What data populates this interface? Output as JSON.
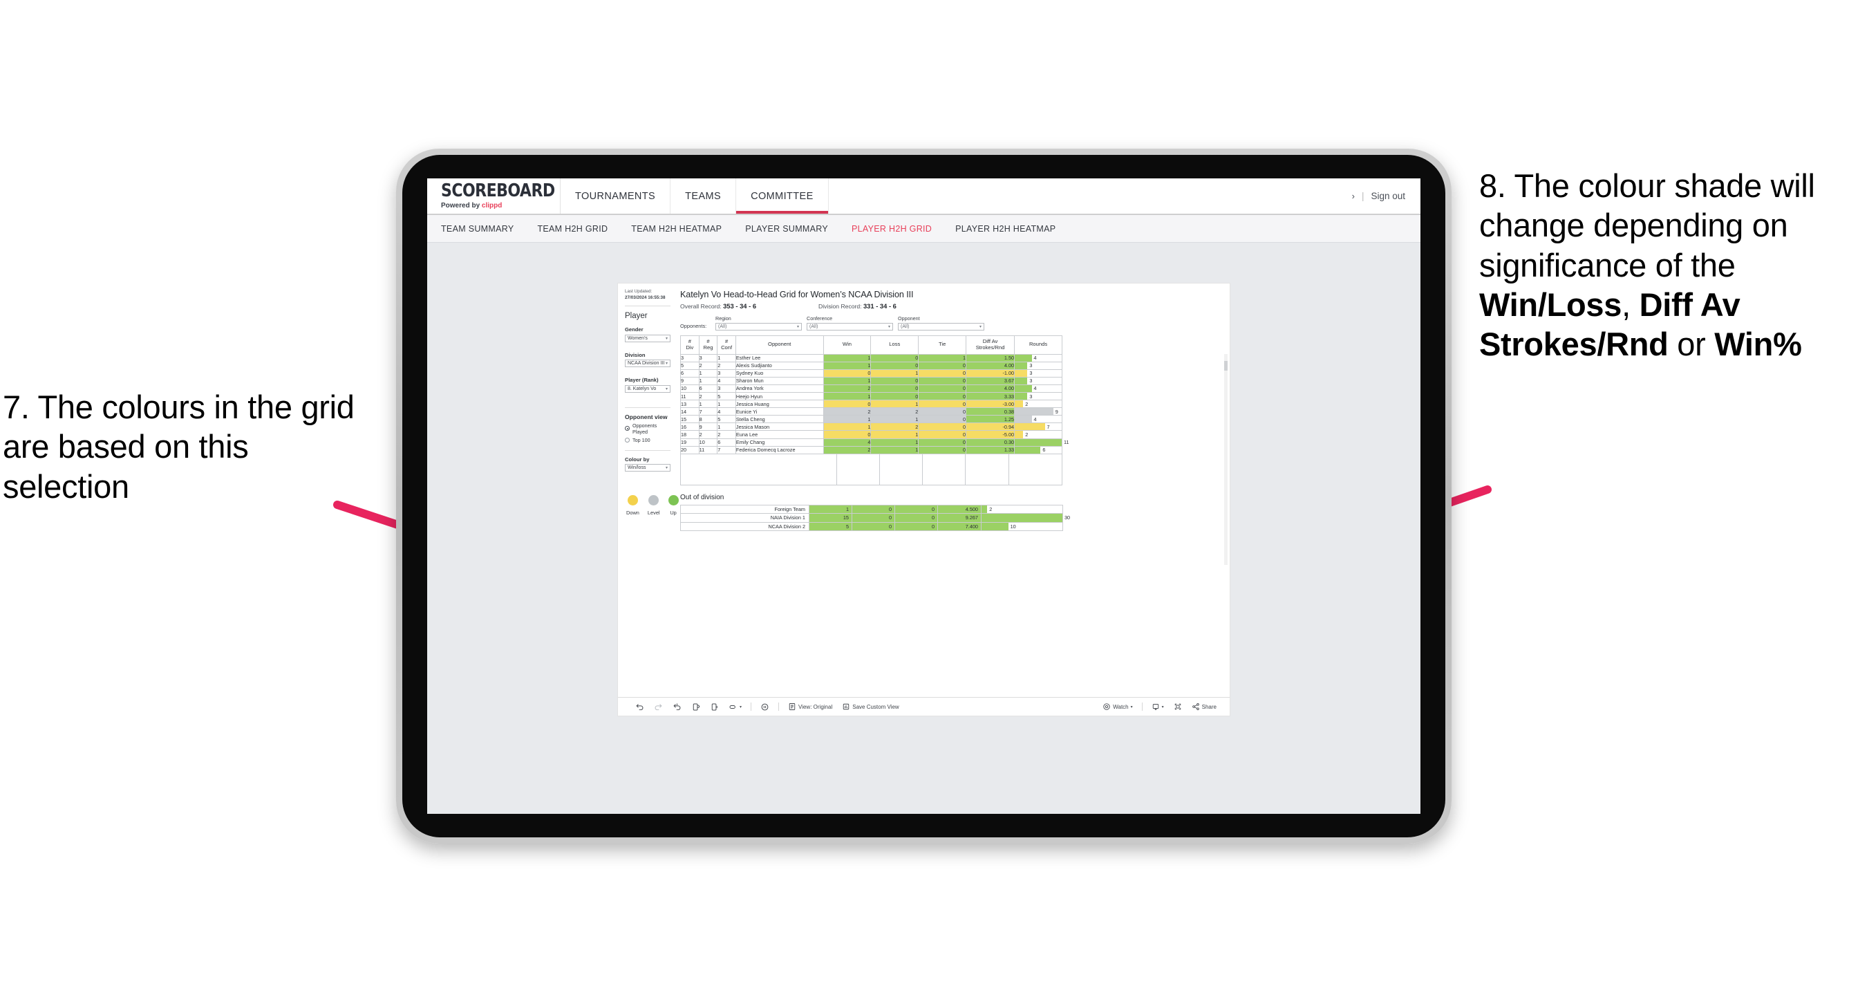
{
  "annotations": {
    "left": "7. The colours in the grid are based on this selection",
    "right_pre": "8. The colour shade will change depending on significance of the ",
    "right_b1": "Win/Loss",
    "right_mid1": ", ",
    "right_b2": "Diff Av Strokes/Rnd",
    "right_mid2": " or ",
    "right_b3": "Win%",
    "arrow_color": "#e8245e"
  },
  "topbar": {
    "brand_title": "SCOREBOARD",
    "brand_sub_pre": "Powered by ",
    "brand_sub_brand": "clippd",
    "nav": [
      {
        "label": "TOURNAMENTS",
        "active": false
      },
      {
        "label": "TEAMS",
        "active": false
      },
      {
        "label": "COMMITTEE",
        "active": true
      }
    ],
    "chevron": "›",
    "separator": "|",
    "sign_out": "Sign out"
  },
  "subnav": [
    {
      "label": "TEAM SUMMARY",
      "active": false
    },
    {
      "label": "TEAM H2H GRID",
      "active": false
    },
    {
      "label": "TEAM H2H HEATMAP",
      "active": false
    },
    {
      "label": "PLAYER SUMMARY",
      "active": false
    },
    {
      "label": "PLAYER H2H GRID",
      "active": true
    },
    {
      "label": "PLAYER H2H HEATMAP",
      "active": false
    }
  ],
  "panel": {
    "last_updated_label": "Last Updated: ",
    "last_updated_value": "27/03/2024 16:55:38",
    "player_heading": "Player",
    "gender_label": "Gender",
    "gender_value": "Women’s",
    "division_label": "Division",
    "division_value": "NCAA Division III",
    "player_rank_label": "Player (Rank)",
    "player_rank_value": "8. Katelyn Vo",
    "opponent_view_heading": "Opponent view",
    "opponent_view_options": [
      {
        "label": "Opponents Played",
        "selected": true
      },
      {
        "label": "Top 100",
        "selected": false
      }
    ],
    "colour_by_label": "Colour by",
    "colour_by_value": "Win/loss",
    "legend": [
      {
        "label": "Down",
        "color": "#f3d14c"
      },
      {
        "label": "Level",
        "color": "#bec3c7"
      },
      {
        "label": "Up",
        "color": "#7dc353"
      }
    ],
    "caret": "▾"
  },
  "main": {
    "title": "Katelyn Vo Head-to-Head Grid for Women’s NCAA Division III",
    "overall_label": "Overall Record: ",
    "overall_value": "353 -  34 - 6",
    "division_label": "Division Record: ",
    "division_value": "331 -  34 - 6",
    "opponents_label": "Opponents:",
    "filters": [
      {
        "label": "Region",
        "value": "(All)"
      },
      {
        "label": "Conference",
        "value": "(All)"
      },
      {
        "label": "Opponent",
        "value": "(All)"
      }
    ],
    "columns": [
      {
        "l1": "#",
        "l2": "Div"
      },
      {
        "l1": "#",
        "l2": "Reg"
      },
      {
        "l1": "#",
        "l2": "Conf"
      },
      {
        "l1": "Opponent",
        "l2": ""
      },
      {
        "l1": "Win",
        "l2": ""
      },
      {
        "l1": "Loss",
        "l2": ""
      },
      {
        "l1": "Tie",
        "l2": ""
      },
      {
        "l1": "Diff Av",
        "l2": "Strokes/Rnd"
      },
      {
        "l1": "Rounds",
        "l2": ""
      }
    ],
    "rows": [
      {
        "div": "3",
        "reg": "3",
        "conf": "1",
        "opponent": "Esther Lee",
        "win": "1",
        "loss": "0",
        "tie": "1",
        "diff": "1.50",
        "rounds": "4",
        "color": "#9bd164",
        "bar_pct": 36
      },
      {
        "div": "5",
        "reg": "2",
        "conf": "2",
        "opponent": "Alexis Sudjianto",
        "win": "1",
        "loss": "0",
        "tie": "0",
        "diff": "4.00",
        "rounds": "3",
        "color": "#9bd164",
        "bar_pct": 27
      },
      {
        "div": "6",
        "reg": "1",
        "conf": "3",
        "opponent": "Sydney Kuo",
        "win": "0",
        "loss": "1",
        "tie": "0",
        "diff": "-1.00",
        "rounds": "3",
        "color": "#f6dc64",
        "bar_pct": 27
      },
      {
        "div": "9",
        "reg": "1",
        "conf": "4",
        "opponent": "Sharon Mun",
        "win": "1",
        "loss": "0",
        "tie": "0",
        "diff": "3.67",
        "rounds": "3",
        "color": "#9bd164",
        "bar_pct": 27
      },
      {
        "div": "10",
        "reg": "6",
        "conf": "3",
        "opponent": "Andrea York",
        "win": "2",
        "loss": "0",
        "tie": "0",
        "diff": "4.00",
        "rounds": "4",
        "color": "#9bd164",
        "bar_pct": 36
      },
      {
        "div": "11",
        "reg": "2",
        "conf": "5",
        "opponent": "Heejo Hyun",
        "win": "1",
        "loss": "0",
        "tie": "0",
        "diff": "3.33",
        "rounds": "3",
        "color": "#9bd164",
        "bar_pct": 27
      },
      {
        "div": "13",
        "reg": "1",
        "conf": "1",
        "opponent": "Jessica Huang",
        "win": "0",
        "loss": "1",
        "tie": "0",
        "diff": "-3.00",
        "rounds": "2",
        "color": "#f6dc64",
        "bar_pct": 18
      },
      {
        "div": "14",
        "reg": "7",
        "conf": "4",
        "opponent": "Eunice Yi",
        "win": "2",
        "loss": "2",
        "tie": "0",
        "diff": "0.38",
        "rounds": "9",
        "color": "#cdd0d3",
        "diff_color": "#9bd164",
        "bar_pct": 82
      },
      {
        "div": "15",
        "reg": "8",
        "conf": "5",
        "opponent": "Stella Cheng",
        "win": "1",
        "loss": "1",
        "tie": "0",
        "diff": "1.25",
        "rounds": "4",
        "color": "#cdd0d3",
        "diff_color": "#9bd164",
        "bar_pct": 36
      },
      {
        "div": "16",
        "reg": "9",
        "conf": "1",
        "opponent": "Jessica Mason",
        "win": "1",
        "loss": "2",
        "tie": "0",
        "diff": "-0.94",
        "rounds": "7",
        "color": "#f6dc64",
        "bar_pct": 64
      },
      {
        "div": "18",
        "reg": "2",
        "conf": "2",
        "opponent": "Euna Lee",
        "win": "0",
        "loss": "1",
        "tie": "0",
        "diff": "-5.00",
        "rounds": "2",
        "color": "#f6dc64",
        "bar_pct": 18
      },
      {
        "div": "19",
        "reg": "10",
        "conf": "6",
        "opponent": "Emily Chang",
        "win": "4",
        "loss": "1",
        "tie": "0",
        "diff": "0.30",
        "rounds": "11",
        "color": "#9bd164",
        "bar_pct": 100
      },
      {
        "div": "20",
        "reg": "11",
        "conf": "7",
        "opponent": "Federica Domecq Lacroze",
        "win": "2",
        "loss": "1",
        "tie": "0",
        "diff": "1.33",
        "rounds": "6",
        "color": "#9bd164",
        "bar_pct": 55
      }
    ],
    "out_of_division_title": "Out of division",
    "out_of_division_rows": [
      {
        "label": "Foreign Team",
        "win": "1",
        "loss": "0",
        "tie": "0",
        "diff": "4.500",
        "rounds": "2",
        "color": "#9bd164",
        "bar_pct": 7
      },
      {
        "label": "NAIA Division 1",
        "win": "15",
        "loss": "0",
        "tie": "0",
        "diff": "9.267",
        "rounds": "30",
        "color": "#9bd164",
        "bar_pct": 100
      },
      {
        "label": "NCAA Division 2",
        "win": "5",
        "loss": "0",
        "tie": "0",
        "diff": "7.400",
        "rounds": "10",
        "color": "#9bd164",
        "bar_pct": 33
      }
    ]
  },
  "toolbar": {
    "view_original": "View: Original",
    "save_custom_view": "Save Custom View",
    "watch": "Watch",
    "share": "Share",
    "caret": "▾"
  }
}
